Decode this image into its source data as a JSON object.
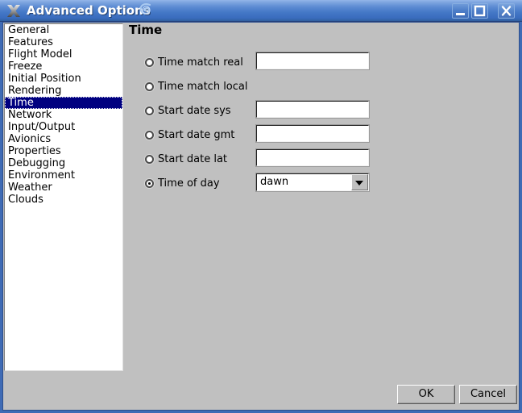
{
  "window": {
    "title": "Advanced Options",
    "app_icon": "x-logo-icon",
    "decoration_icon": "swirl-icon",
    "titlebar_color": "#4377c6",
    "controls": {
      "minimize": "minimize-icon",
      "maximize": "maximize-icon",
      "close": "close-icon"
    }
  },
  "sidebar": {
    "selected_index": 6,
    "items": [
      {
        "label": "General"
      },
      {
        "label": "Features"
      },
      {
        "label": "Flight Model"
      },
      {
        "label": "Freeze"
      },
      {
        "label": "Initial Position"
      },
      {
        "label": "Rendering"
      },
      {
        "label": "Time"
      },
      {
        "label": "Network"
      },
      {
        "label": "Input/Output"
      },
      {
        "label": "Avionics"
      },
      {
        "label": "Properties"
      },
      {
        "label": "Debugging"
      },
      {
        "label": "Environment"
      },
      {
        "label": "Weather"
      },
      {
        "label": "Clouds"
      }
    ],
    "selection_color": "#000080"
  },
  "panel": {
    "heading": "Time",
    "rows": [
      {
        "label": "Time match real",
        "selected": false,
        "control": "text",
        "value": ""
      },
      {
        "label": "Time match local",
        "selected": false,
        "control": "none",
        "value": ""
      },
      {
        "label": "Start date sys",
        "selected": false,
        "control": "text",
        "value": ""
      },
      {
        "label": "Start date gmt",
        "selected": false,
        "control": "text",
        "value": ""
      },
      {
        "label": "Start date lat",
        "selected": false,
        "control": "text",
        "value": ""
      },
      {
        "label": "Time of day",
        "selected": true,
        "control": "combo",
        "value": "dawn"
      }
    ]
  },
  "footer": {
    "ok_label": "OK",
    "cancel_label": "Cancel"
  }
}
